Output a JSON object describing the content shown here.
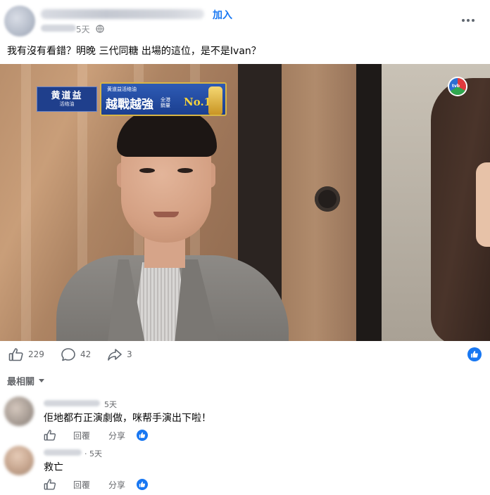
{
  "post": {
    "join_label": "加入",
    "time_label": "5天",
    "text": "我有沒有看錯？明晚 三代同糖 出場的這位，是不是Ivan？"
  },
  "video": {
    "ad_logo_big": "黄道益",
    "ad_logo_small": "活络油",
    "ad_top": "黄道益活络油",
    "ad_main": "越戰越強",
    "ad_sub_line1": "全港",
    "ad_sub_line2": "銷量",
    "ad_no1": "No.1",
    "channel_logo": "tvb"
  },
  "reactions": {
    "likes": "229",
    "comments": "42",
    "shares": "3"
  },
  "sort_label": "最相關",
  "comments": [
    {
      "time": "5天",
      "text": "佢地都冇正演劇做，咪帮手演出下啦！",
      "reply_label": "回覆",
      "share_label": "分享"
    },
    {
      "time": "· 5天",
      "text": "救亡",
      "reply_label": "回覆",
      "share_label": "分享"
    }
  ],
  "colors": {
    "accent": "#1877f2",
    "muted": "#65676b"
  }
}
